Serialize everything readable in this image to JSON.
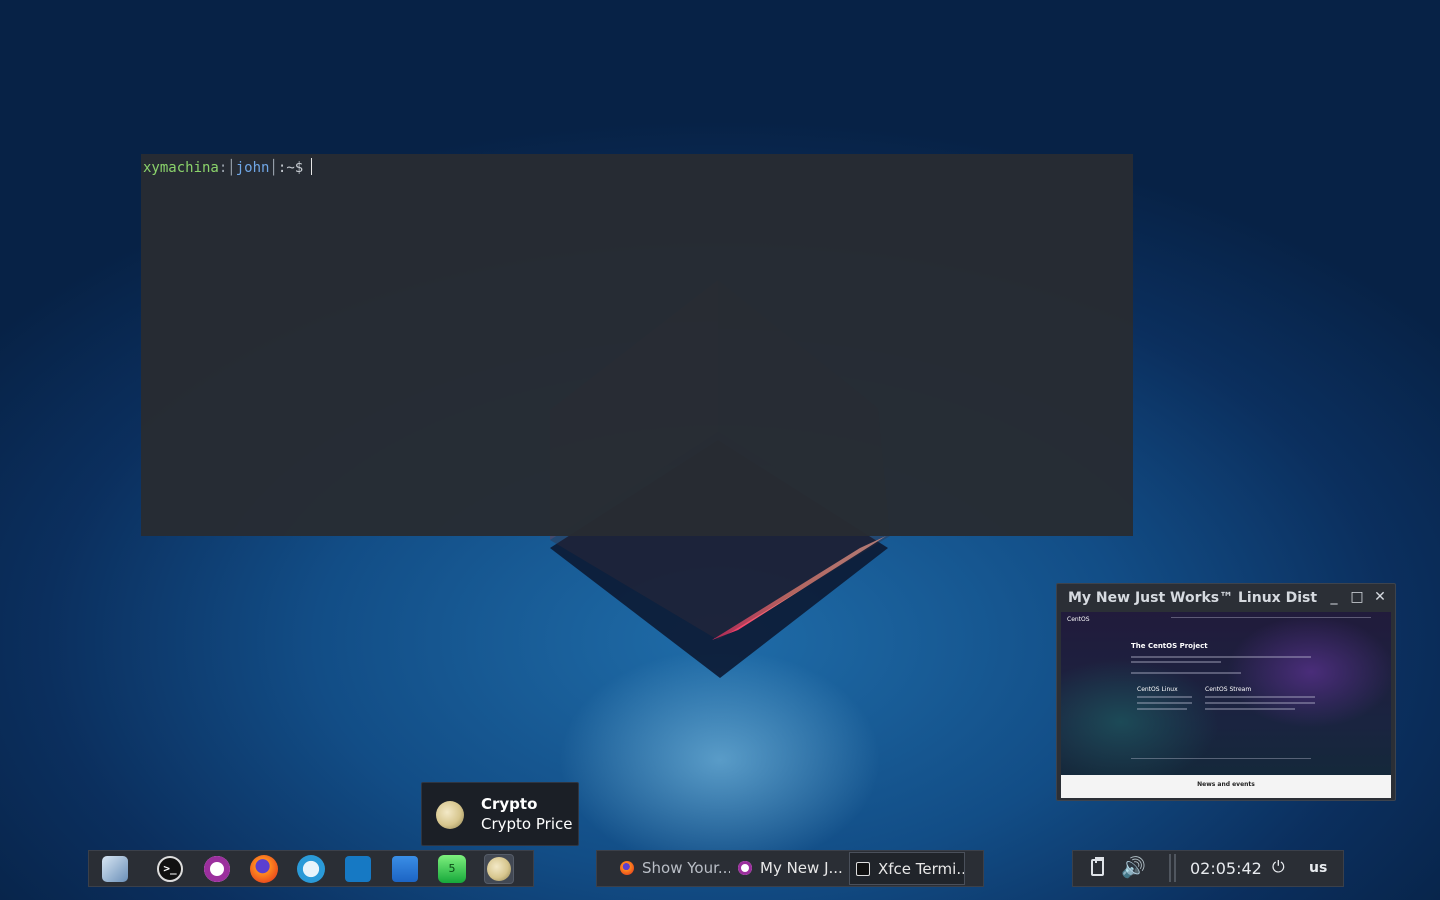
{
  "terminal": {
    "host": "xymachina",
    "colon1": ":",
    "user": "john",
    "path": ":~$"
  },
  "tooltip": {
    "title": "Crypto",
    "subtitle": "Crypto Price"
  },
  "preview": {
    "title": "My New Just Works™ Linux Distro (its",
    "minimize": "_",
    "maximize": "□",
    "close": "✕",
    "thumb": {
      "brand": "CentOS",
      "heading": "The CentOS Project",
      "col1": "CentOS Linux",
      "col2": "CentOS Stream",
      "footer": "News and events"
    }
  },
  "launcher": {
    "items": [
      {
        "icon": "app-finder-icon"
      },
      {
        "icon": "terminal-icon",
        "glyph": ">_"
      },
      {
        "icon": "media-player-icon"
      },
      {
        "icon": "firefox-icon"
      },
      {
        "icon": "chat-icon"
      },
      {
        "icon": "wireshark-icon"
      },
      {
        "icon": "rss-icon"
      },
      {
        "icon": "gem-icon",
        "glyph": "5"
      },
      {
        "icon": "crypto-moon-icon"
      }
    ]
  },
  "tasks": [
    {
      "label": "Show Your...",
      "icon": "firefox-icon"
    },
    {
      "label": "My New J...",
      "icon": "media-player-icon"
    },
    {
      "label": "Xfce Termi...",
      "icon": "terminal-icon"
    }
  ],
  "tray": {
    "clock": "02:05:42",
    "power": "⏻",
    "keyboard": "us",
    "volume": "🔊"
  }
}
